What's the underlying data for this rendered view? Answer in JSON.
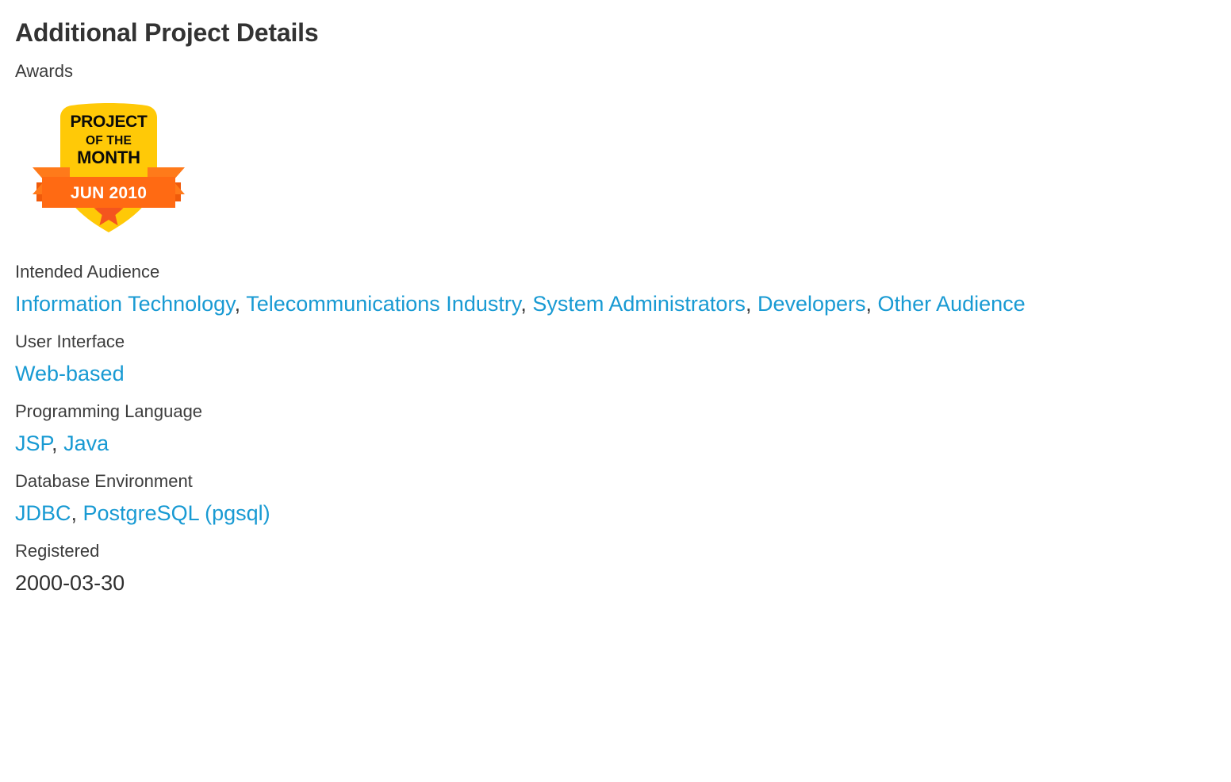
{
  "page": {
    "title": "Additional Project Details",
    "background_color": "#ffffff",
    "text_color": "#3c3c3c",
    "link_color": "#189ad3"
  },
  "badge": {
    "award_name": "Project of the Month",
    "line1": "PROJECT",
    "line2": "OF THE",
    "line3": "MONTH",
    "ribbon_date": "JUN 2010",
    "shield_color": "#FFC907",
    "ribbon_color": "#FF6A13",
    "ribbon_tail_color": "#FF7A1A",
    "ribbon_fold_color": "#F05A0A",
    "star_color": "#F4551E",
    "text_color": "#0a0a0a",
    "ribbon_text_color": "#ffffff"
  },
  "fields": [
    {
      "label": "Awards",
      "type": "badge"
    },
    {
      "label": "Intended Audience",
      "type": "links",
      "links": [
        "Information Technology",
        "Telecommunications Industry",
        "System Administrators",
        "Developers",
        "Other Audience"
      ],
      "separator": ", "
    },
    {
      "label": "User Interface",
      "type": "links",
      "links": [
        "Web-based"
      ],
      "separator": ", "
    },
    {
      "label": "Programming Language",
      "type": "links",
      "links": [
        "JSP",
        "Java"
      ],
      "separator": ", "
    },
    {
      "label": "Database Environment",
      "type": "links",
      "links": [
        "JDBC",
        "PostgreSQL (pgsql)"
      ],
      "separator": ", "
    },
    {
      "label": "Registered",
      "type": "text",
      "value": "2000-03-30"
    }
  ]
}
